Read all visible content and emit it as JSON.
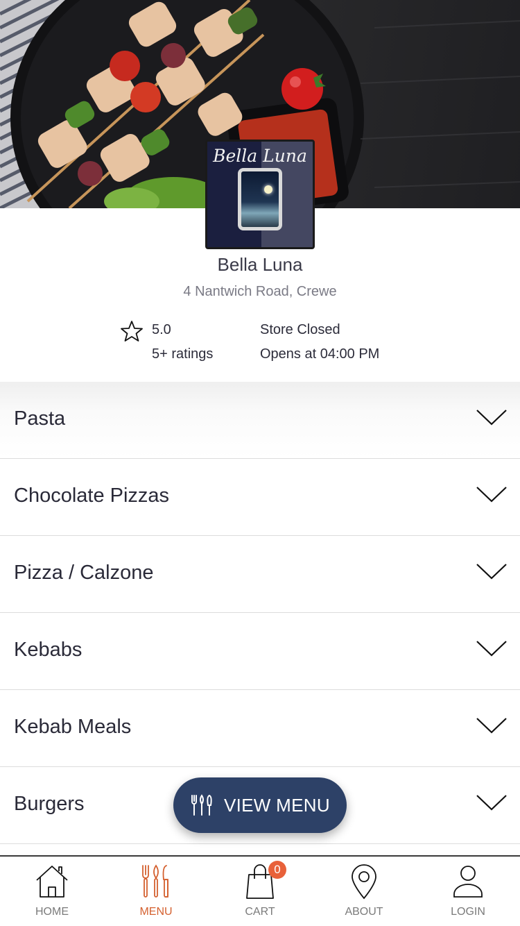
{
  "store": {
    "logo_text": "Bella Luna",
    "name": "Bella Luna",
    "address": "4 Nantwich Road, Crewe",
    "rating": "5.0",
    "rating_count": "5+ ratings",
    "status": "Store Closed",
    "opens": "Opens at 04:00 PM"
  },
  "categories": [
    {
      "label": "Pasta",
      "icon": "chevron-down-icon"
    },
    {
      "label": "Chocolate Pizzas",
      "icon": "chevron-down-icon"
    },
    {
      "label": "Pizza / Calzone",
      "icon": "chevron-down-icon"
    },
    {
      "label": "Kebabs",
      "icon": "chevron-down-icon"
    },
    {
      "label": "Kebab Meals",
      "icon": "chevron-down-icon"
    },
    {
      "label": "Burgers",
      "icon": "chevron-down-icon"
    }
  ],
  "view_menu": {
    "label": "VIEW MENU",
    "icon": "cutlery-icon",
    "color": "#2d4167"
  },
  "tabbar": {
    "active_color": "#d4602f",
    "items": [
      {
        "label": "HOME",
        "icon": "home-icon"
      },
      {
        "label": "MENU",
        "icon": "cutlery-icon"
      },
      {
        "label": "CART",
        "icon": "shopping-bag-icon",
        "badge": "0"
      },
      {
        "label": "ABOUT",
        "icon": "location-pin-icon"
      },
      {
        "label": "LOGIN",
        "icon": "user-icon"
      }
    ],
    "active": "MENU"
  }
}
